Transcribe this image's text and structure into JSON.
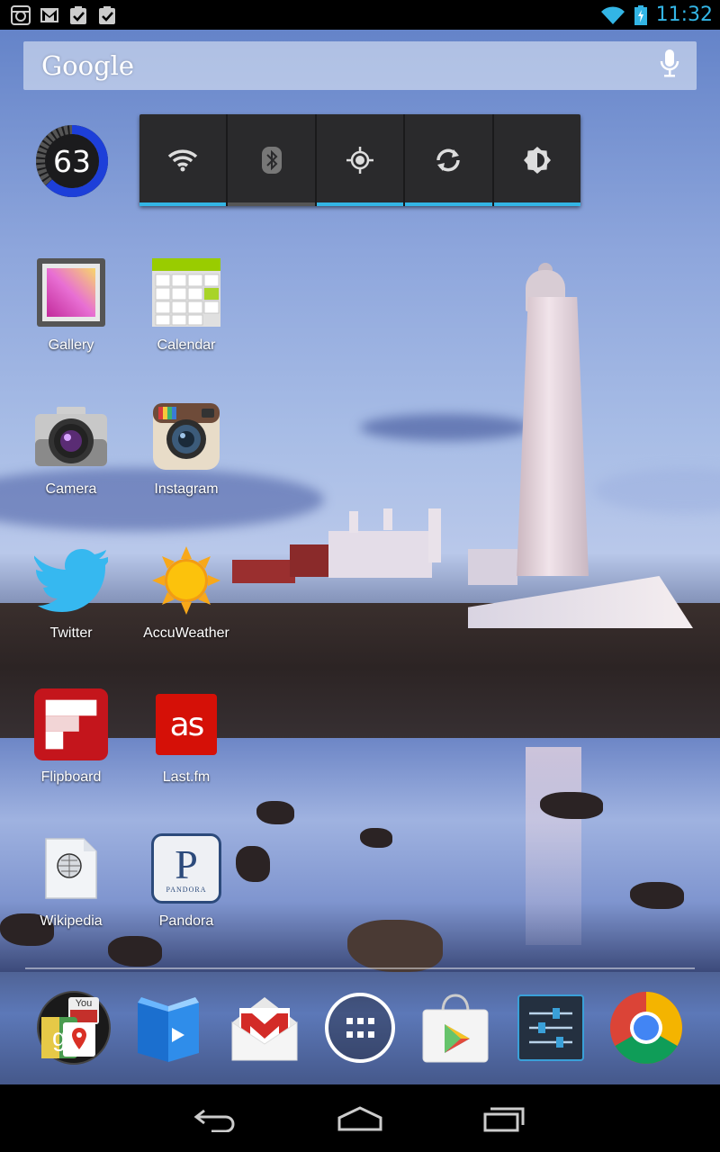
{
  "status_bar": {
    "time": "11:32",
    "left_icons": [
      "instagram-notification-icon",
      "gmail-notification-icon",
      "task-done-icon",
      "task-done-icon"
    ],
    "right_icons": [
      "wifi-signal-icon",
      "battery-charging-icon"
    ]
  },
  "search": {
    "label": "Google",
    "icon": "microphone-icon"
  },
  "battery_widget": {
    "value": "63",
    "level": 0.63
  },
  "power_control": {
    "toggles": [
      {
        "name": "wifi",
        "icon": "wifi-icon",
        "on": true
      },
      {
        "name": "bluetooth",
        "icon": "bluetooth-icon",
        "on": false
      },
      {
        "name": "gps",
        "icon": "gps-icon",
        "on": true
      },
      {
        "name": "sync",
        "icon": "sync-icon",
        "on": true
      },
      {
        "name": "brightness",
        "icon": "brightness-icon",
        "on": true
      }
    ]
  },
  "apps": [
    {
      "label": "Gallery",
      "icon": "gallery-icon"
    },
    {
      "label": "Calendar",
      "icon": "calendar-icon"
    },
    {
      "label": "Camera",
      "icon": "camera-icon"
    },
    {
      "label": "Instagram",
      "icon": "instagram-icon"
    },
    {
      "label": "Twitter",
      "icon": "twitter-icon"
    },
    {
      "label": "AccuWeather",
      "icon": "accuweather-sun-icon"
    },
    {
      "label": "Flipboard",
      "icon": "flipboard-icon"
    },
    {
      "label": "Last.fm",
      "icon": "lastfm-icon"
    },
    {
      "label": "Wikipedia",
      "icon": "wikipedia-icon"
    },
    {
      "label": "Pandora",
      "icon": "pandora-icon"
    }
  ],
  "icon_text": {
    "lastfm": "as",
    "pandora_letter": "P",
    "pandora_word": "PANDORA",
    "youtube": "You"
  },
  "dock": [
    {
      "icon": "google-apps-folder-icon"
    },
    {
      "icon": "play-books-icon"
    },
    {
      "icon": "gmail-icon"
    },
    {
      "icon": "all-apps-icon"
    },
    {
      "icon": "play-store-icon"
    },
    {
      "icon": "settings-icon"
    },
    {
      "icon": "chrome-icon"
    }
  ],
  "navigation": [
    "back-icon",
    "home-icon",
    "recent-apps-icon"
  ],
  "colors": {
    "accent": "#33b5e5",
    "status_bar": "#000000"
  }
}
